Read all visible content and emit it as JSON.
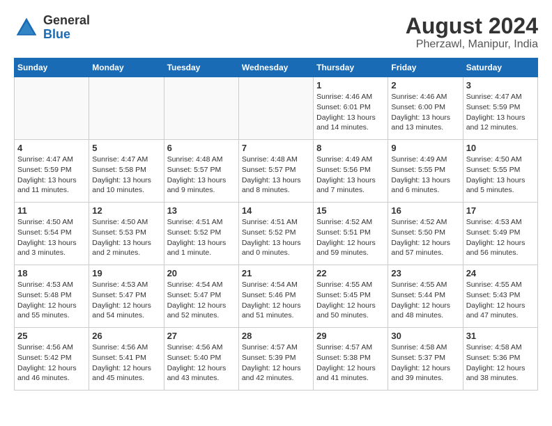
{
  "header": {
    "logo": {
      "general": "General",
      "blue": "Blue"
    },
    "title": "August 2024",
    "subtitle": "Pherzawl, Manipur, India"
  },
  "calendar": {
    "days_of_week": [
      "Sunday",
      "Monday",
      "Tuesday",
      "Wednesday",
      "Thursday",
      "Friday",
      "Saturday"
    ],
    "weeks": [
      [
        {
          "day": "",
          "info": ""
        },
        {
          "day": "",
          "info": ""
        },
        {
          "day": "",
          "info": ""
        },
        {
          "day": "",
          "info": ""
        },
        {
          "day": "1",
          "info": "Sunrise: 4:46 AM\nSunset: 6:01 PM\nDaylight: 13 hours and 14 minutes."
        },
        {
          "day": "2",
          "info": "Sunrise: 4:46 AM\nSunset: 6:00 PM\nDaylight: 13 hours and 13 minutes."
        },
        {
          "day": "3",
          "info": "Sunrise: 4:47 AM\nSunset: 5:59 PM\nDaylight: 13 hours and 12 minutes."
        }
      ],
      [
        {
          "day": "4",
          "info": "Sunrise: 4:47 AM\nSunset: 5:59 PM\nDaylight: 13 hours and 11 minutes."
        },
        {
          "day": "5",
          "info": "Sunrise: 4:47 AM\nSunset: 5:58 PM\nDaylight: 13 hours and 10 minutes."
        },
        {
          "day": "6",
          "info": "Sunrise: 4:48 AM\nSunset: 5:57 PM\nDaylight: 13 hours and 9 minutes."
        },
        {
          "day": "7",
          "info": "Sunrise: 4:48 AM\nSunset: 5:57 PM\nDaylight: 13 hours and 8 minutes."
        },
        {
          "day": "8",
          "info": "Sunrise: 4:49 AM\nSunset: 5:56 PM\nDaylight: 13 hours and 7 minutes."
        },
        {
          "day": "9",
          "info": "Sunrise: 4:49 AM\nSunset: 5:55 PM\nDaylight: 13 hours and 6 minutes."
        },
        {
          "day": "10",
          "info": "Sunrise: 4:50 AM\nSunset: 5:55 PM\nDaylight: 13 hours and 5 minutes."
        }
      ],
      [
        {
          "day": "11",
          "info": "Sunrise: 4:50 AM\nSunset: 5:54 PM\nDaylight: 13 hours and 3 minutes."
        },
        {
          "day": "12",
          "info": "Sunrise: 4:50 AM\nSunset: 5:53 PM\nDaylight: 13 hours and 2 minutes."
        },
        {
          "day": "13",
          "info": "Sunrise: 4:51 AM\nSunset: 5:52 PM\nDaylight: 13 hours and 1 minute."
        },
        {
          "day": "14",
          "info": "Sunrise: 4:51 AM\nSunset: 5:52 PM\nDaylight: 13 hours and 0 minutes."
        },
        {
          "day": "15",
          "info": "Sunrise: 4:52 AM\nSunset: 5:51 PM\nDaylight: 12 hours and 59 minutes."
        },
        {
          "day": "16",
          "info": "Sunrise: 4:52 AM\nSunset: 5:50 PM\nDaylight: 12 hours and 57 minutes."
        },
        {
          "day": "17",
          "info": "Sunrise: 4:53 AM\nSunset: 5:49 PM\nDaylight: 12 hours and 56 minutes."
        }
      ],
      [
        {
          "day": "18",
          "info": "Sunrise: 4:53 AM\nSunset: 5:48 PM\nDaylight: 12 hours and 55 minutes."
        },
        {
          "day": "19",
          "info": "Sunrise: 4:53 AM\nSunset: 5:47 PM\nDaylight: 12 hours and 54 minutes."
        },
        {
          "day": "20",
          "info": "Sunrise: 4:54 AM\nSunset: 5:47 PM\nDaylight: 12 hours and 52 minutes."
        },
        {
          "day": "21",
          "info": "Sunrise: 4:54 AM\nSunset: 5:46 PM\nDaylight: 12 hours and 51 minutes."
        },
        {
          "day": "22",
          "info": "Sunrise: 4:55 AM\nSunset: 5:45 PM\nDaylight: 12 hours and 50 minutes."
        },
        {
          "day": "23",
          "info": "Sunrise: 4:55 AM\nSunset: 5:44 PM\nDaylight: 12 hours and 48 minutes."
        },
        {
          "day": "24",
          "info": "Sunrise: 4:55 AM\nSunset: 5:43 PM\nDaylight: 12 hours and 47 minutes."
        }
      ],
      [
        {
          "day": "25",
          "info": "Sunrise: 4:56 AM\nSunset: 5:42 PM\nDaylight: 12 hours and 46 minutes."
        },
        {
          "day": "26",
          "info": "Sunrise: 4:56 AM\nSunset: 5:41 PM\nDaylight: 12 hours and 45 minutes."
        },
        {
          "day": "27",
          "info": "Sunrise: 4:56 AM\nSunset: 5:40 PM\nDaylight: 12 hours and 43 minutes."
        },
        {
          "day": "28",
          "info": "Sunrise: 4:57 AM\nSunset: 5:39 PM\nDaylight: 12 hours and 42 minutes."
        },
        {
          "day": "29",
          "info": "Sunrise: 4:57 AM\nSunset: 5:38 PM\nDaylight: 12 hours and 41 minutes."
        },
        {
          "day": "30",
          "info": "Sunrise: 4:58 AM\nSunset: 5:37 PM\nDaylight: 12 hours and 39 minutes."
        },
        {
          "day": "31",
          "info": "Sunrise: 4:58 AM\nSunset: 5:36 PM\nDaylight: 12 hours and 38 minutes."
        }
      ]
    ]
  }
}
